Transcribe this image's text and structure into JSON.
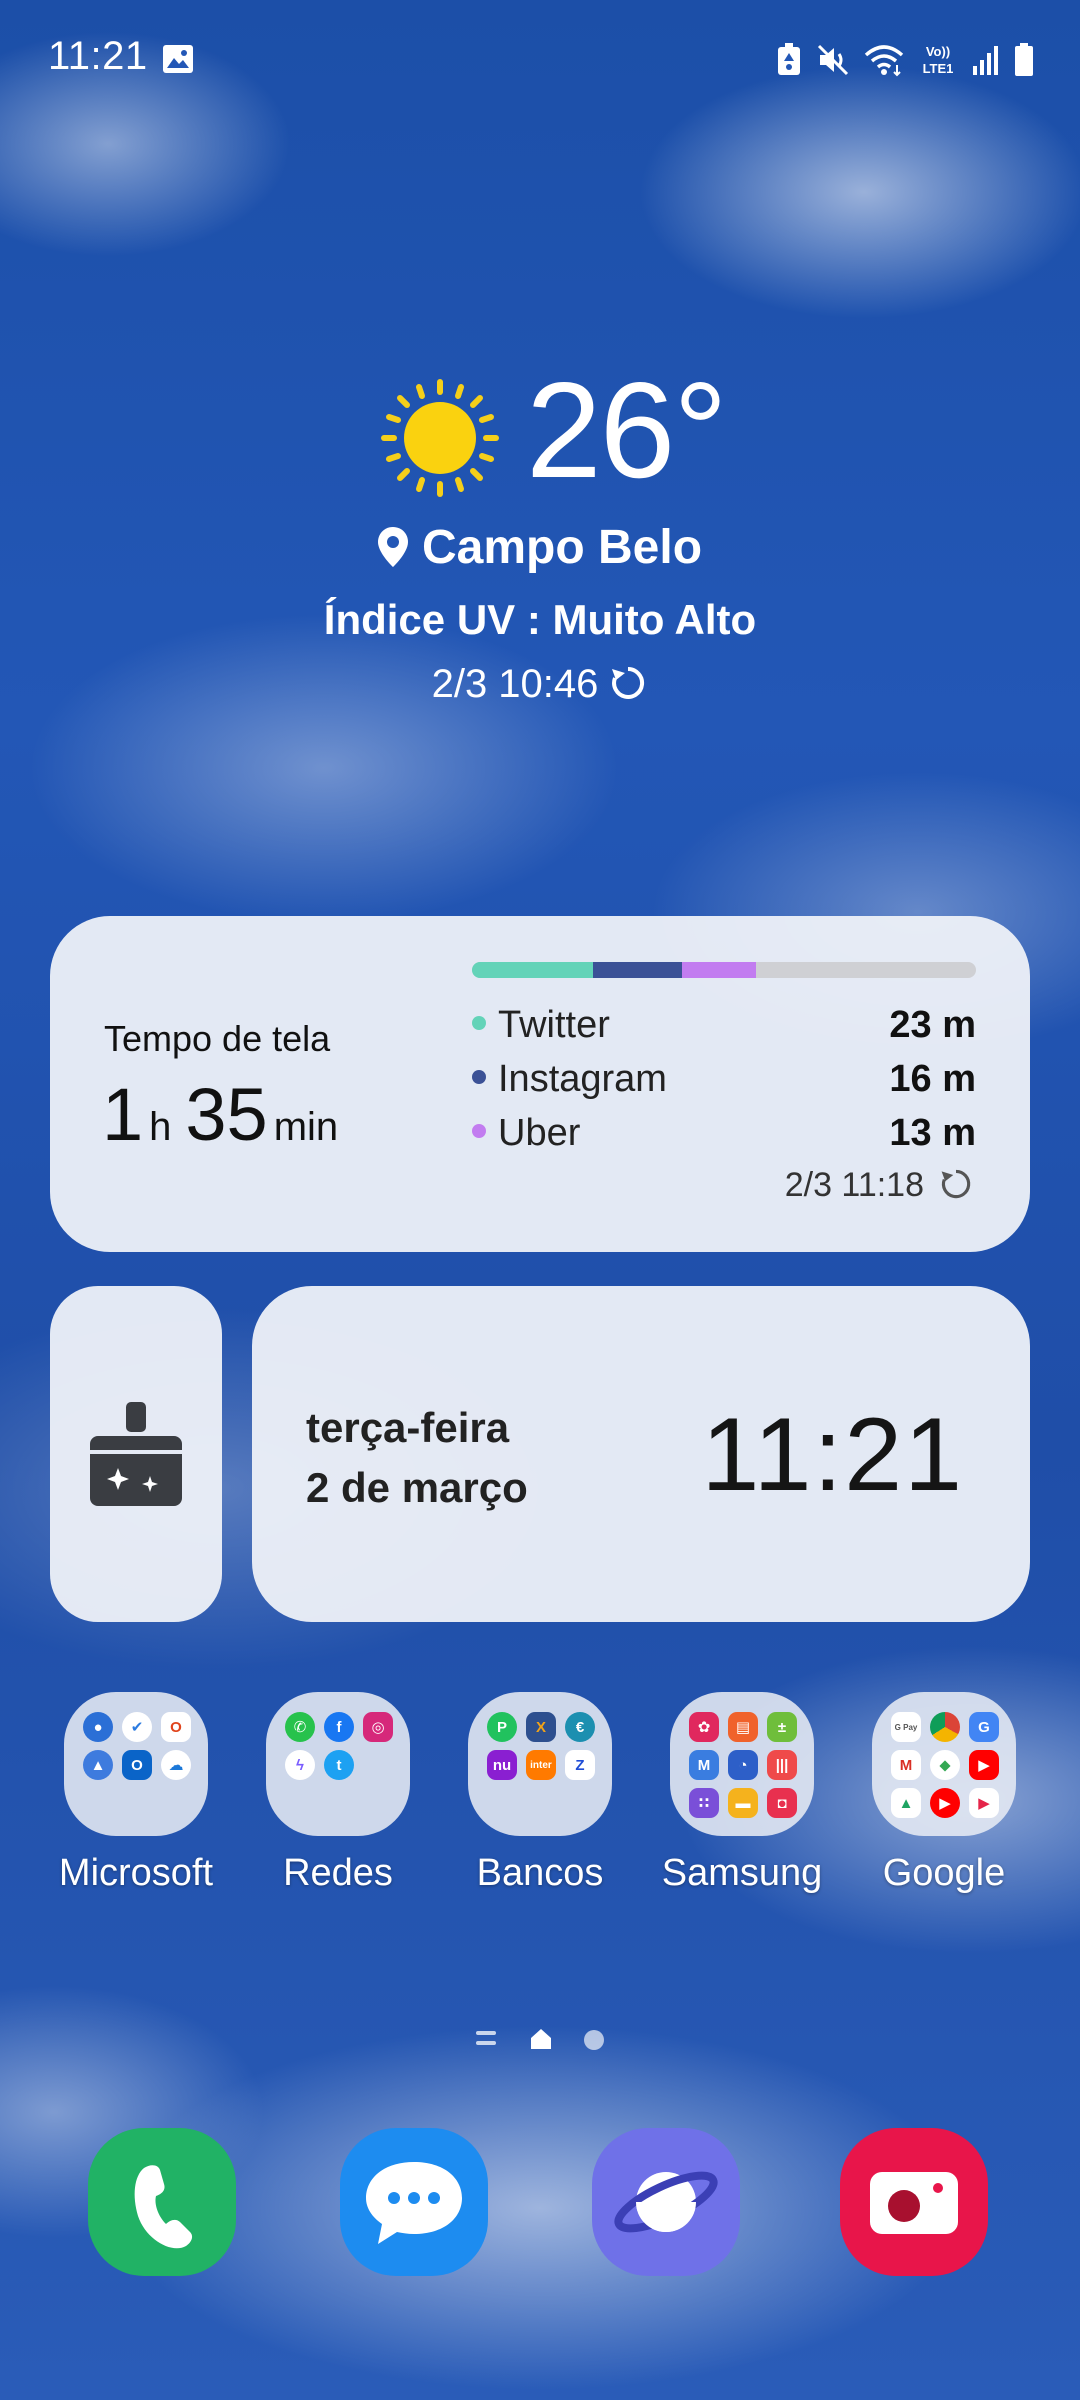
{
  "status_bar": {
    "time": "11:21",
    "icons": [
      "gallery-icon",
      "battery-saver-icon",
      "mute-icon",
      "wifi-icon",
      "volte-icon",
      "signal-icon",
      "battery-icon"
    ],
    "volte_label_top": "Vo))",
    "volte_label_bottom": "LTE1"
  },
  "weather": {
    "temperature": "26°",
    "location": "Campo Belo",
    "uv": "Índice UV : Muito Alto",
    "updated": "2/3 10:46"
  },
  "screen_time": {
    "title": "Tempo de tela",
    "hours": "1",
    "hours_unit": "h",
    "minutes": "35",
    "minutes_unit": "min",
    "apps": [
      {
        "name": "Twitter",
        "duration": "23 m",
        "color": "#63d3b8"
      },
      {
        "name": "Instagram",
        "duration": "16 m",
        "color": "#3b5196"
      },
      {
        "name": "Uber",
        "duration": "13 m",
        "color": "#c27cf0"
      }
    ],
    "updated": "2/3 11:18"
  },
  "clock_widget": {
    "weekday": "terça-feira",
    "date": "2 de março",
    "time": "11:21"
  },
  "folders": [
    {
      "label": "Microsoft"
    },
    {
      "label": "Redes"
    },
    {
      "label": "Bancos"
    },
    {
      "label": "Samsung"
    },
    {
      "label": "Google"
    }
  ],
  "folder_icon_text": {
    "inter": "inter",
    "gpay": "G Pay"
  },
  "dock": [
    "phone-app-icon",
    "messages-app-icon",
    "internet-app-icon",
    "camera-app-icon"
  ],
  "colors": {
    "phone": "#21b265",
    "messages": "#1d8cf0",
    "internet": "#6f71e8",
    "camera": "#e8154a"
  }
}
